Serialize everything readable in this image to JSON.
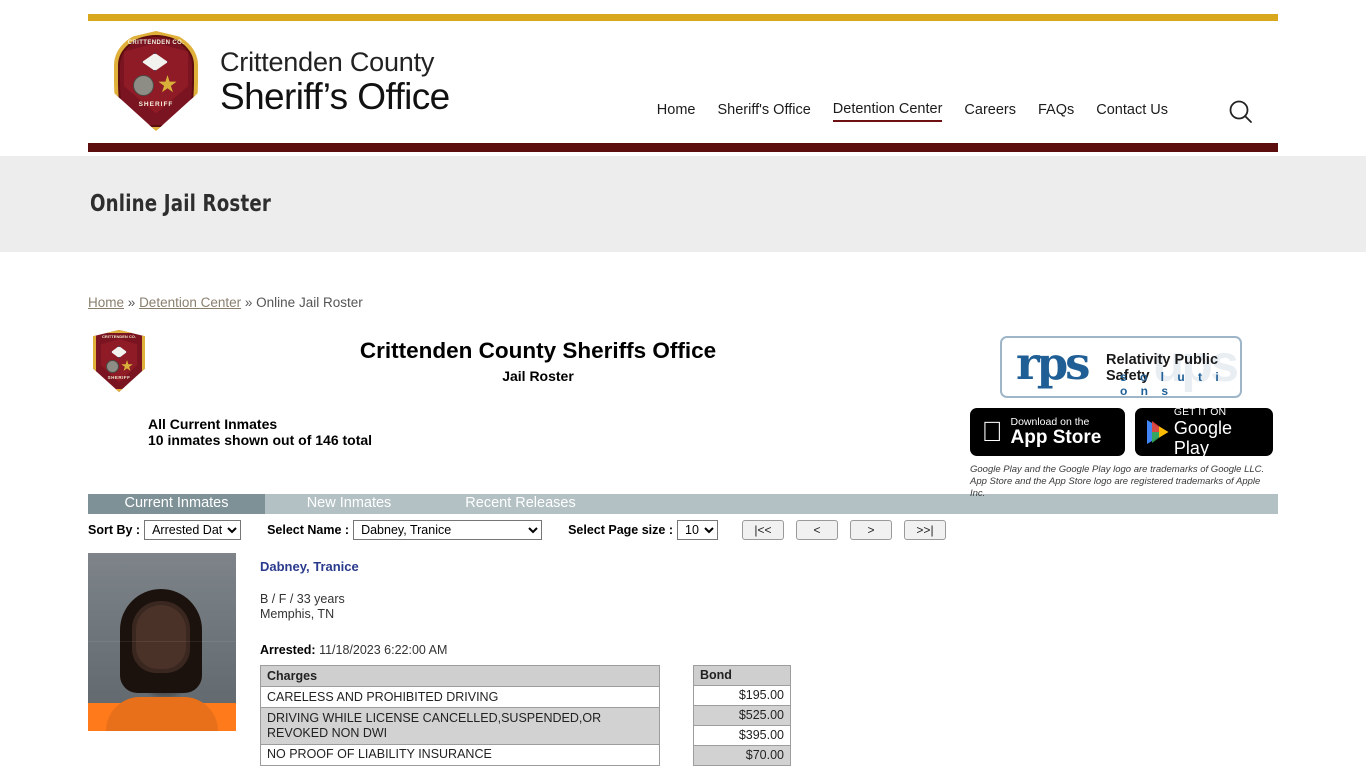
{
  "site": {
    "brand_line1": "Crittenden County",
    "brand_line2": "Sheriff’s Office",
    "badge_top_text": "CRITTENDEN CO.",
    "badge_bottom_text": "SHERIFF",
    "nav": [
      {
        "label": "Home",
        "active": false
      },
      {
        "label": "Sheriff's Office",
        "active": false
      },
      {
        "label": "Detention Center",
        "active": true
      },
      {
        "label": "Careers",
        "active": false
      },
      {
        "label": "FAQs",
        "active": false
      },
      {
        "label": "Contact Us",
        "active": false
      }
    ],
    "search_icon": "search-icon",
    "colors": {
      "top_rule": "#d9a71c",
      "bottom_rule": "#5c0d0d",
      "banner_bg": "#ededed",
      "tab_bar": "#b3c0c4",
      "tab_active": "#7d9197",
      "link": "#2a3a8c"
    }
  },
  "banner": {
    "title": "Online Jail Roster"
  },
  "breadcrumb": {
    "items": [
      {
        "label": "Home",
        "link": true
      },
      {
        "label": "Detention Center",
        "link": true
      },
      {
        "label": "Online Jail Roster",
        "link": false
      }
    ],
    "separator": "»"
  },
  "roster": {
    "title": "Crittenden County Sheriffs Office",
    "subtitle": "Jail Roster",
    "count_line1": "All Current Inmates",
    "count_line2": "10 inmates shown out of 146 total",
    "shown": 10,
    "total": 146
  },
  "rps": {
    "logo_main": "rps",
    "logo_ghost": "ups",
    "tagline1": "Relativity Public Safety",
    "tagline2": "s o l u t i o n s",
    "app_store": {
      "small": "Download on the",
      "large": "App Store"
    },
    "google_play": {
      "small": "GET IT ON",
      "large": "Google Play"
    },
    "trademark_line1": "Google Play and the Google Play logo are trademarks of Google LLC.",
    "trademark_line2": "App Store and the App Store logo are registered trademarks of Apple Inc."
  },
  "tabs": [
    {
      "label": "Current Inmates",
      "active": true
    },
    {
      "label": "New Inmates",
      "active": false
    },
    {
      "label": "Recent Releases",
      "active": false
    }
  ],
  "controls": {
    "sort_label": "Sort By :",
    "sort_value": "Arrested Date",
    "sort_options": [
      "Arrested Date"
    ],
    "name_label": "Select Name :",
    "name_value": "Dabney, Tranice",
    "name_options": [
      "Dabney, Tranice"
    ],
    "page_size_label": "Select Page size :",
    "page_size_value": "10",
    "page_size_options": [
      "10"
    ],
    "pager": {
      "first": "|<<",
      "prev": "<",
      "next": ">",
      "last": ">>|"
    }
  },
  "inmate": {
    "name": "Dabney, Tranice",
    "demographics": "B / F / 33 years",
    "city_state": "Memphis, TN",
    "arrested_label": "Arrested:",
    "arrested_value": "11/18/2023 6:22:00 AM",
    "mugshot_alt": "inmate-mugshot",
    "table": {
      "header_charges": "Charges",
      "header_bond": "Bond",
      "rows": [
        {
          "charge": "CARELESS AND PROHIBITED DRIVING",
          "bond": "$195.00"
        },
        {
          "charge": "DRIVING WHILE LICENSE CANCELLED,SUSPENDED,OR REVOKED NON DWI",
          "bond": "$525.00"
        },
        {
          "charge": "NO PROOF OF LIABILITY INSURANCE",
          "bond": "$395.00"
        },
        {
          "charge": "",
          "bond": "$70.00"
        }
      ]
    }
  }
}
